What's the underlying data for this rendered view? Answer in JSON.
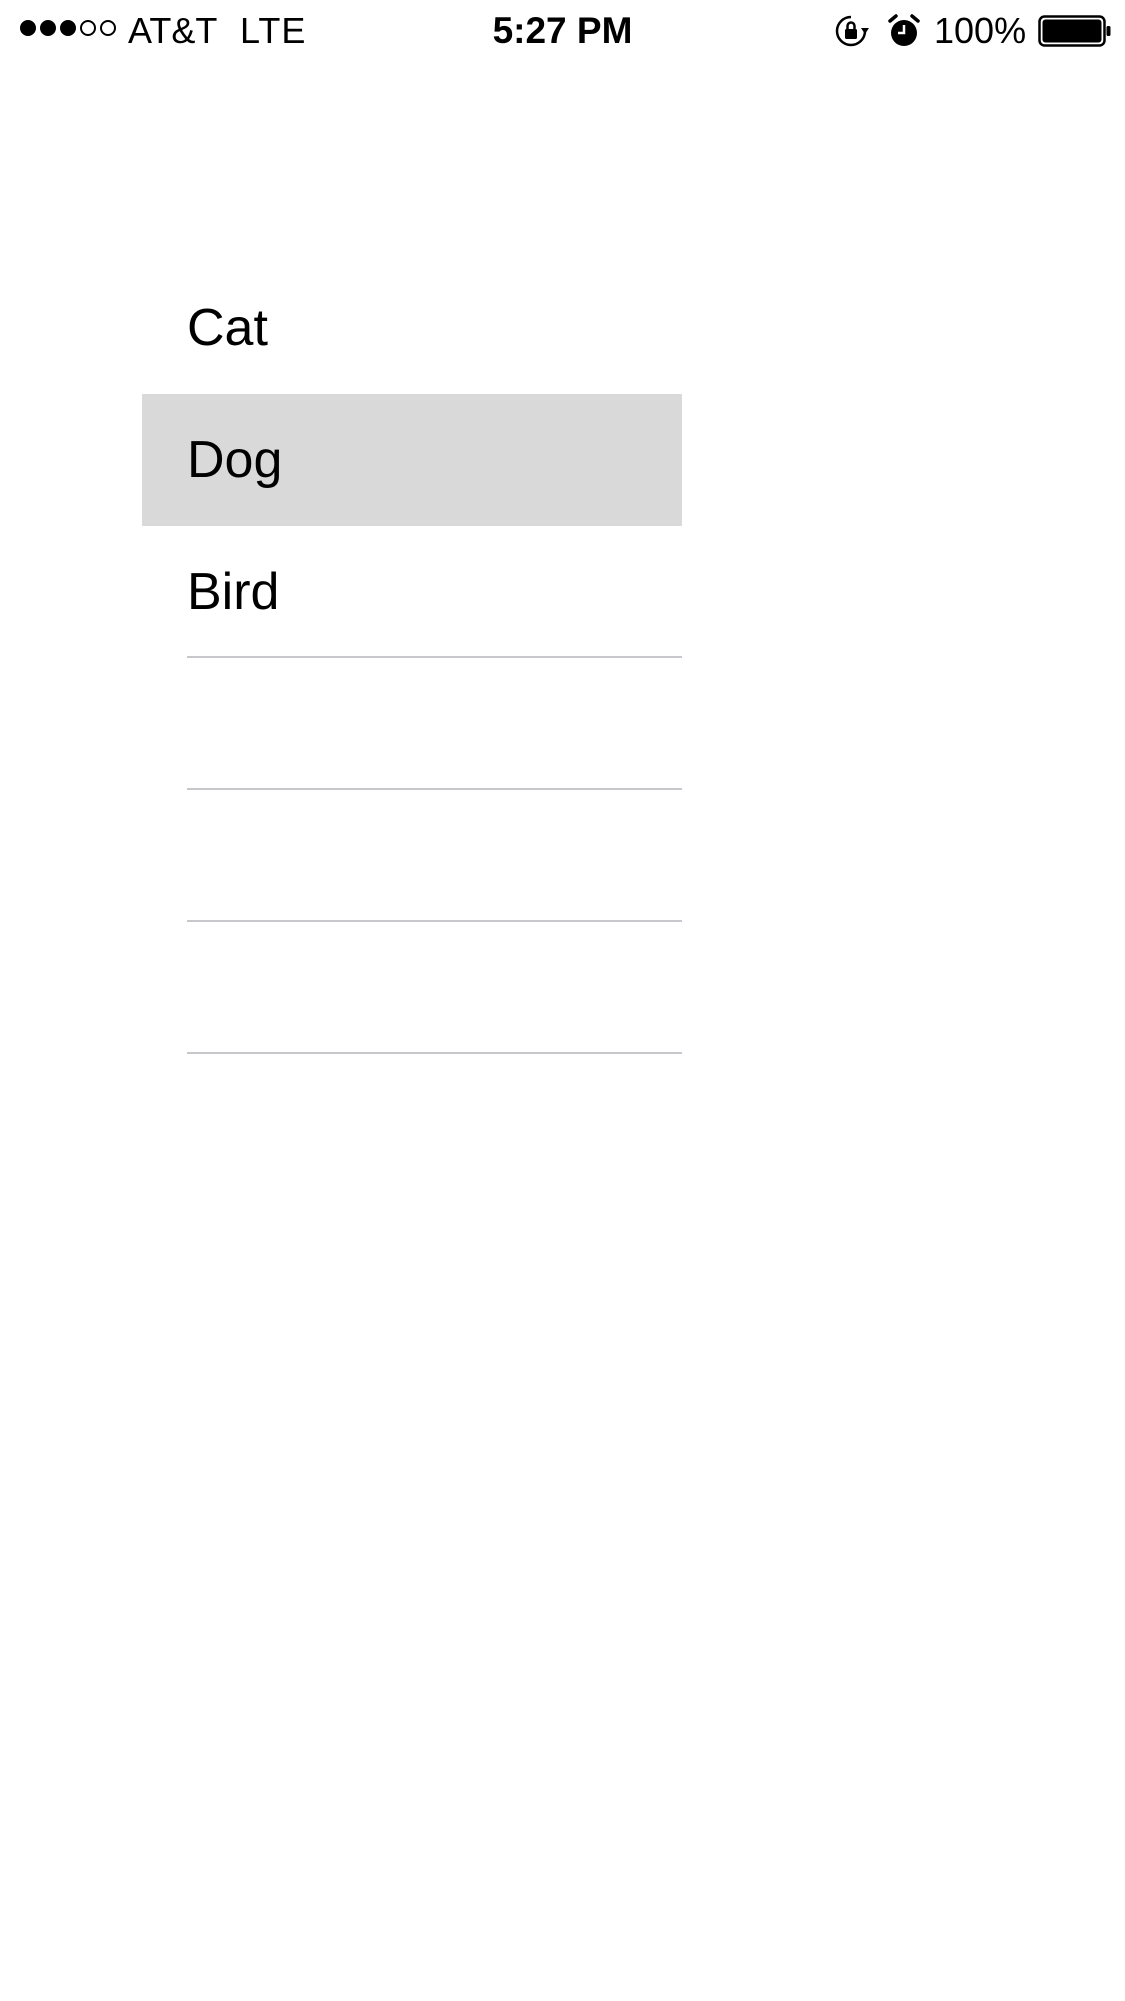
{
  "status_bar": {
    "signal_bars_filled": 3,
    "signal_bars_total": 5,
    "carrier": "AT&T",
    "network": "LTE",
    "time": "5:27 PM",
    "battery_percent": "100%",
    "battery_level": 1.0,
    "icons": [
      "rotation-lock-icon",
      "alarm-icon",
      "battery-icon"
    ]
  },
  "list": {
    "items": [
      {
        "label": "Cat",
        "selected": false
      },
      {
        "label": "Dog",
        "selected": true
      },
      {
        "label": "Bird",
        "selected": false
      },
      {
        "label": "",
        "selected": false
      },
      {
        "label": "",
        "selected": false
      },
      {
        "label": "",
        "selected": false
      }
    ],
    "selected_color": "#d9d9d9",
    "separator_color": "#c8c8cc"
  }
}
